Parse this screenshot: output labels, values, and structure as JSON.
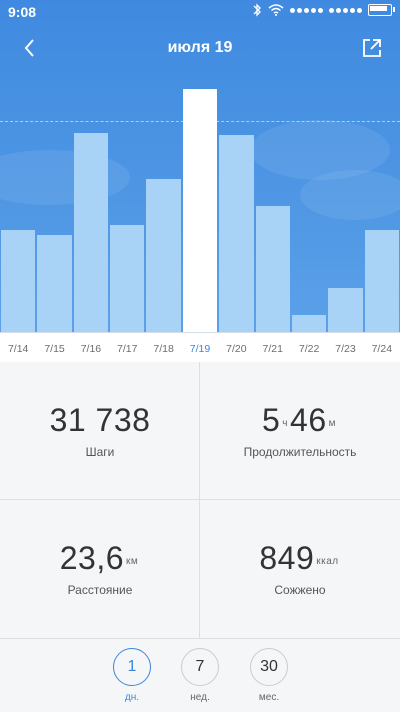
{
  "status_bar": {
    "time": "9:08",
    "icons": [
      "bluetooth-icon",
      "wifi-icon",
      "signal-icon",
      "signal-icon",
      "battery-icon"
    ]
  },
  "header": {
    "title": "июля 19",
    "back_icon": "chevron-left-icon",
    "share_icon": "share-icon"
  },
  "chart_data": {
    "type": "bar",
    "categories": [
      "7/14",
      "7/15",
      "7/16",
      "7/17",
      "7/18",
      "7/19",
      "7/20",
      "7/21",
      "7/22",
      "7/23",
      "7/24"
    ],
    "values": [
      0.42,
      0.4,
      0.82,
      0.44,
      0.63,
      1.0,
      0.81,
      0.52,
      0.07,
      0.18,
      0.42
    ],
    "selected_index": 5,
    "reference_line_level": 0.87,
    "grid": false
  },
  "colors": {
    "accent": "#3d86d8",
    "bar": "#a9d3f6",
    "bar_selected": "#ffffff",
    "header_bg": "#4a92e2"
  },
  "stats": {
    "steps": {
      "value": "31 738",
      "label": "Шаги"
    },
    "duration": {
      "hours": "5",
      "hours_unit": "ч",
      "minutes": "46",
      "minutes_unit": "м",
      "label": "Продолжительность"
    },
    "distance": {
      "value": "23,6",
      "unit": "км",
      "label": "Расстояние"
    },
    "calories": {
      "value": "849",
      "unit": "ккал",
      "label": "Сожжено"
    }
  },
  "periods": [
    {
      "value": "1",
      "label": "дн.",
      "active": true
    },
    {
      "value": "7",
      "label": "нед.",
      "active": false
    },
    {
      "value": "30",
      "label": "мес.",
      "active": false
    }
  ]
}
